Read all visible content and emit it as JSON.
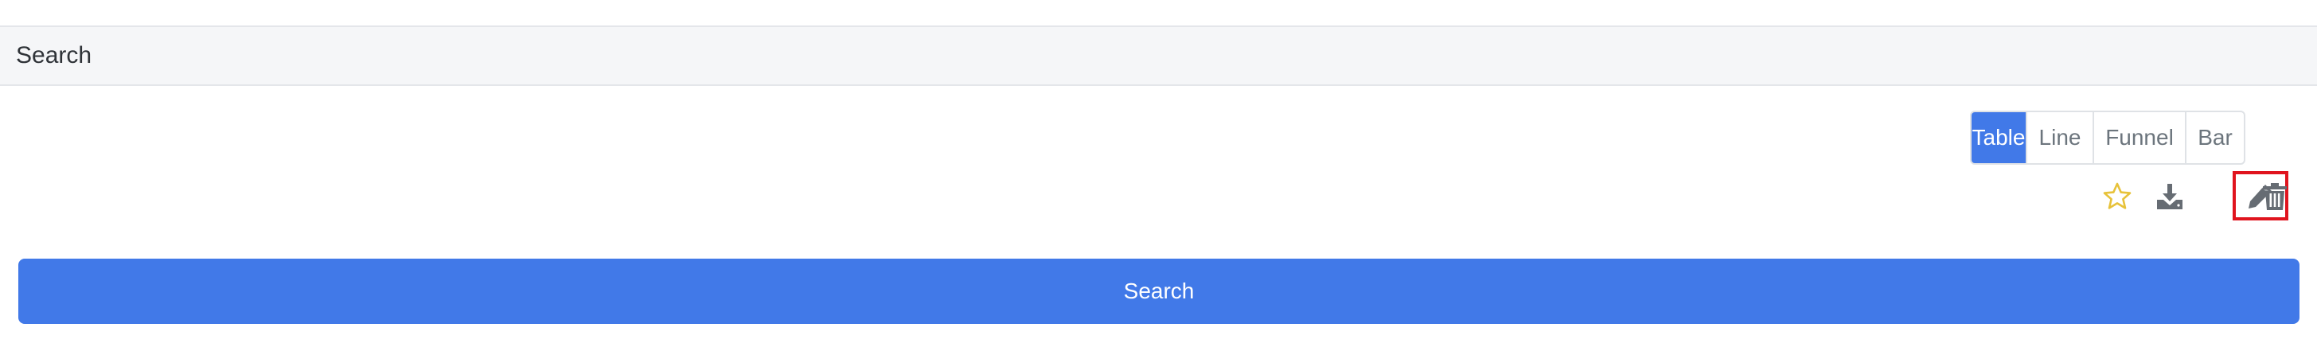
{
  "panel": {
    "title": "Search"
  },
  "view_toggle": {
    "options": [
      "Table",
      "Line",
      "Funnel",
      "Bar"
    ],
    "selected": "Table"
  },
  "actions": {
    "icons": [
      "star-icon",
      "download-icon",
      "edit-icon",
      "trash-icon"
    ],
    "highlighted": "edit-icon"
  },
  "search_button": {
    "label": "Search"
  },
  "colors": {
    "accent": "#4179e8",
    "star": "#e7c23a",
    "icon": "#666c73",
    "highlight_border": "#e0141e",
    "header_bg": "#f5f6f8"
  }
}
